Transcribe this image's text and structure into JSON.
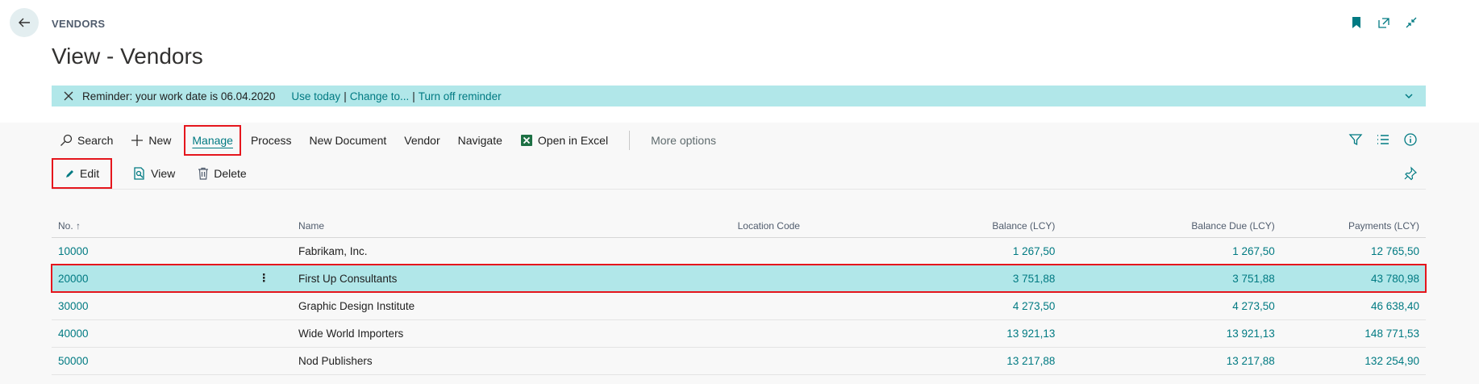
{
  "header": {
    "caption": "VENDORS",
    "title": "View - Vendors"
  },
  "reminder": {
    "text": "Reminder: your work date is 06.04.2020",
    "use_today": "Use today",
    "change_to": "Change to...",
    "turn_off": "Turn off reminder",
    "sep": "|"
  },
  "actions": {
    "search": "Search",
    "new": "New",
    "manage": "Manage",
    "process": "Process",
    "new_document": "New Document",
    "vendor": "Vendor",
    "navigate": "Navigate",
    "open_excel": "Open in Excel",
    "more_options": "More options"
  },
  "subactions": {
    "edit": "Edit",
    "view": "View",
    "delete": "Delete"
  },
  "table": {
    "columns": {
      "no": "No. ↑",
      "name": "Name",
      "location": "Location Code",
      "balance": "Balance (LCY)",
      "balance_due": "Balance Due (LCY)",
      "payments": "Payments (LCY)"
    },
    "rows": [
      {
        "no": "10000",
        "name": "Fabrikam, Inc.",
        "location": "",
        "balance": "1 267,50",
        "balance_due": "1 267,50",
        "payments": "12 765,50"
      },
      {
        "no": "20000",
        "name": "First Up Consultants",
        "location": "",
        "balance": "3 751,88",
        "balance_due": "3 751,88",
        "payments": "43 780,98"
      },
      {
        "no": "30000",
        "name": "Graphic Design Institute",
        "location": "",
        "balance": "4 273,50",
        "balance_due": "4 273,50",
        "payments": "46 638,40"
      },
      {
        "no": "40000",
        "name": "Wide World Importers",
        "location": "",
        "balance": "13 921,13",
        "balance_due": "13 921,13",
        "payments": "148 771,53"
      },
      {
        "no": "50000",
        "name": "Nod Publishers",
        "location": "",
        "balance": "13 217,88",
        "balance_due": "13 217,88",
        "payments": "132 254,90"
      }
    ],
    "selected_row_menu": "⋮"
  },
  "colors": {
    "accent": "#007a82",
    "reminder_bg": "#b1e7e9",
    "highlight_border": "#e5161d"
  }
}
